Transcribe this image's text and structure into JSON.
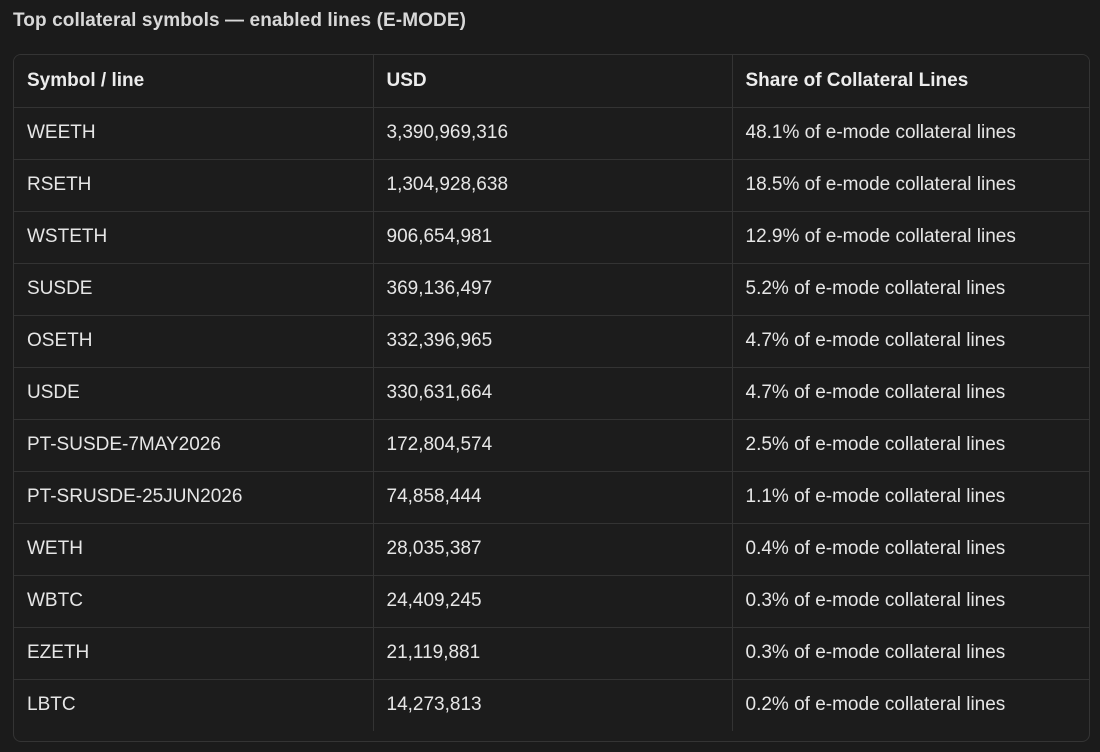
{
  "title": "Top collateral symbols — enabled lines (E-MODE)",
  "table": {
    "headers": [
      "Symbol / line",
      "USD",
      "Share of Collateral Lines"
    ],
    "rows": [
      [
        "WEETH",
        "3,390,969,316",
        "48.1% of e-mode collateral lines"
      ],
      [
        "RSETH",
        "1,304,928,638",
        "18.5% of e-mode collateral lines"
      ],
      [
        "WSTETH",
        "906,654,981",
        "12.9% of e-mode collateral lines"
      ],
      [
        "SUSDE",
        "369,136,497",
        "5.2% of e-mode collateral lines"
      ],
      [
        "OSETH",
        "332,396,965",
        "4.7% of e-mode collateral lines"
      ],
      [
        "USDE",
        "330,631,664",
        "4.7% of e-mode collateral lines"
      ],
      [
        "PT-SUSDE-7MAY2026",
        "172,804,574",
        "2.5% of e-mode collateral lines"
      ],
      [
        "PT-SRUSDE-25JUN2026",
        "74,858,444",
        "1.1% of e-mode collateral lines"
      ],
      [
        "WETH",
        "28,035,387",
        "0.4% of e-mode collateral lines"
      ],
      [
        "WBTC",
        "24,409,245",
        "0.3% of e-mode collateral lines"
      ],
      [
        "EZETH",
        "21,119,881",
        "0.3% of e-mode collateral lines"
      ],
      [
        "LBTC",
        "14,273,813",
        "0.2% of e-mode collateral lines"
      ]
    ]
  }
}
